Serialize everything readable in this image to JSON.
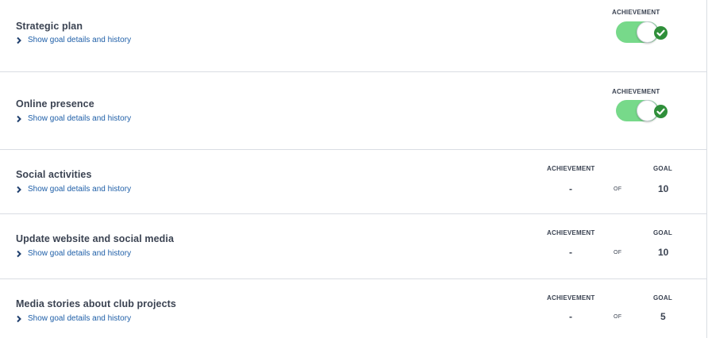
{
  "goals": [
    {
      "title": "Strategic plan",
      "details_link": "Show goal details and history",
      "achievement_label": "ACHIEVEMENT",
      "toggle_state": "on"
    },
    {
      "title": "Online presence",
      "details_link": "Show goal details and history",
      "achievement_label": "ACHIEVEMENT",
      "toggle_state": "on"
    },
    {
      "title": "Social activities",
      "details_link": "Show goal details and history",
      "achievement_label": "ACHIEVEMENT",
      "goal_label": "GOAL",
      "achievement_value": "-",
      "of_label": "OF",
      "goal_value": "10"
    },
    {
      "title": "Update website and social media",
      "details_link": "Show goal details and history",
      "achievement_label": "ACHIEVEMENT",
      "goal_label": "GOAL",
      "achievement_value": "-",
      "of_label": "OF",
      "goal_value": "10"
    },
    {
      "title": "Media stories about club projects",
      "details_link": "Show goal details and history",
      "achievement_label": "ACHIEVEMENT",
      "goal_label": "GOAL",
      "achievement_value": "-",
      "of_label": "OF",
      "goal_value": "5"
    }
  ],
  "icons": {
    "expand": "chevron-right-icon",
    "achieved": "check-circle-icon"
  },
  "colors": {
    "toggle_on": "#77d98a",
    "check_badge": "#2f8f3a",
    "link": "#1f5fa8",
    "divider": "#d9dde3",
    "text": "#3b4352"
  }
}
